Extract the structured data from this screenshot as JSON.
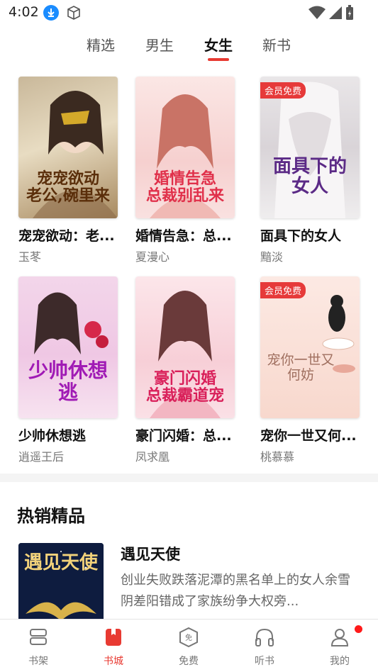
{
  "status_bar": {
    "time": "4:02"
  },
  "tabs": [
    {
      "label": "精选"
    },
    {
      "label": "男生"
    },
    {
      "label": "女生",
      "active": true
    },
    {
      "label": "新书"
    }
  ],
  "books": [
    {
      "cover_title": "宠宠欲动\n老公,碗里来",
      "title": "宠宠欲动：老...",
      "author": "玉苳",
      "badge": ""
    },
    {
      "cover_title": "婚情告急\n总裁别乱来",
      "title": "婚情告急：总...",
      "author": "夏漫心",
      "badge": ""
    },
    {
      "cover_title": "面具下的女人",
      "title": "面具下的女人",
      "author": "黯淡",
      "badge": "会员免费"
    },
    {
      "cover_title": "少帅休想逃",
      "title": "少帅休想逃",
      "author": "逍遥王后",
      "badge": ""
    },
    {
      "cover_title": "豪门闪婚\n总裁霸道宠",
      "title": "豪门闪婚：总...",
      "author": "凤求凰",
      "badge": ""
    },
    {
      "cover_title": "宠你一世又何妨",
      "title": "宠你一世又何...",
      "author": "桃慕慕",
      "badge": "会员免费"
    }
  ],
  "hot_section": {
    "title": "热销精品",
    "item": {
      "cover_title": "遇见天使",
      "name": "遇见天使",
      "desc": "创业失败跌落泥潭的黑名单上的女人余雪阴差阳错成了家族纷争大权旁..."
    }
  },
  "bottom_nav": [
    {
      "label": "书架",
      "icon": "bookshelf-icon"
    },
    {
      "label": "书城",
      "icon": "bookstore-icon",
      "active": true
    },
    {
      "label": "免费",
      "icon": "free-icon"
    },
    {
      "label": "听书",
      "icon": "headphones-icon"
    },
    {
      "label": "我的",
      "icon": "profile-icon"
    }
  ],
  "colors": {
    "accent": "#e83a32",
    "badge": "#e63a3a"
  }
}
